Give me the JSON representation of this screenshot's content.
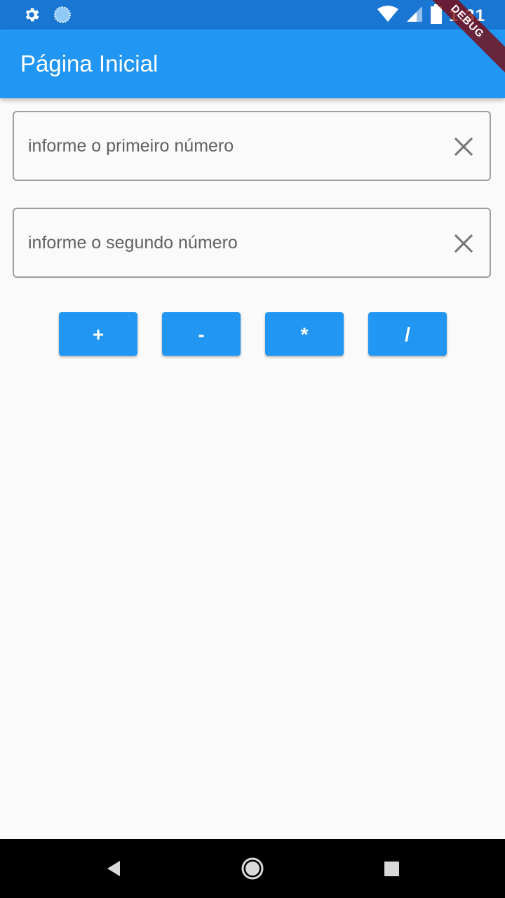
{
  "status_bar": {
    "time": "1:31",
    "icons": [
      "settings-icon",
      "sync-icon",
      "wifi-icon",
      "cell-signal-icon",
      "battery-icon"
    ]
  },
  "debug_banner": "DEBUG",
  "app_bar": {
    "title": "Página Inicial"
  },
  "inputs": {
    "first": {
      "placeholder": "informe o primeiro número",
      "value": ""
    },
    "second": {
      "placeholder": "informe o segundo número",
      "value": ""
    }
  },
  "operations": {
    "add": "+",
    "subtract": "-",
    "multiply": "*",
    "divide": "/"
  },
  "nav_bar": {
    "icons": [
      "back-icon",
      "home-icon",
      "recent-apps-icon"
    ]
  },
  "colors": {
    "primary": "#2196f3",
    "primary_dark": "#1976d2",
    "background": "#fafafa"
  }
}
